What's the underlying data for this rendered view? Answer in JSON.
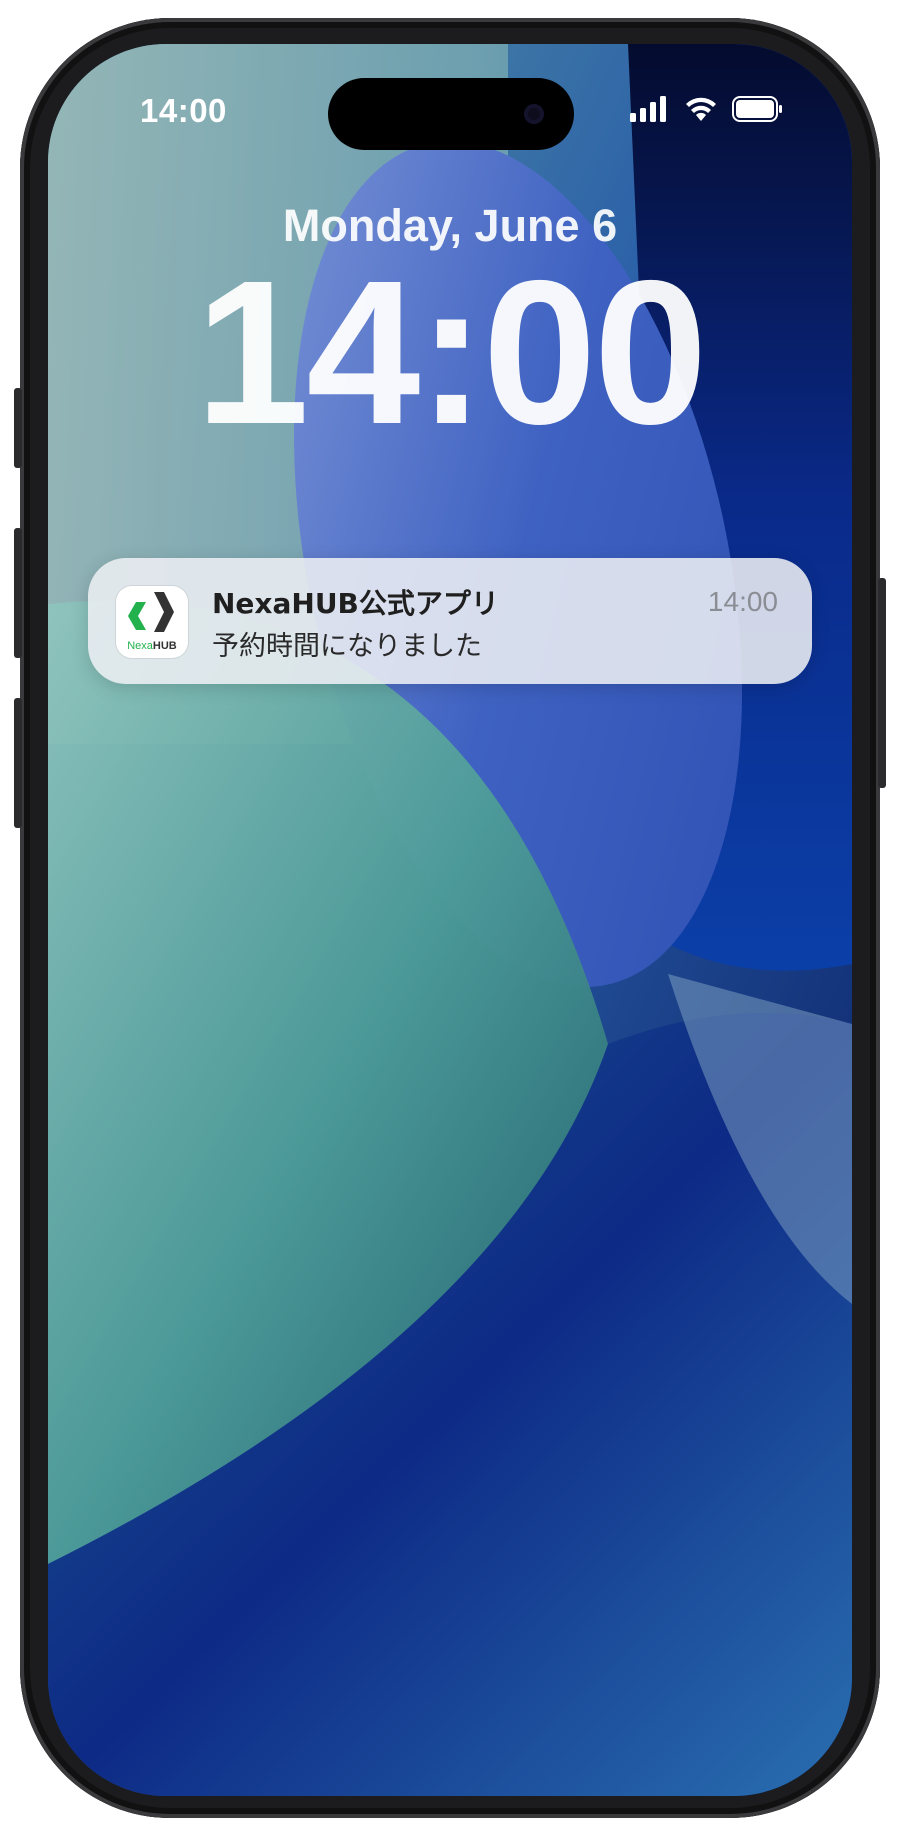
{
  "status_bar": {
    "time": "14:00",
    "icons": [
      "signal-icon",
      "wifi-icon",
      "battery-icon"
    ]
  },
  "lock_screen": {
    "date": "Monday, June 6",
    "clock": "14:00"
  },
  "notification": {
    "app_name": "NexaHUB公式アプリ",
    "time": "14:00",
    "message": "予約時間になりました",
    "icon": {
      "label_part1": "Nexa",
      "label_part2": "HUB",
      "accent_color": "#22b14c",
      "dark_color": "#333333"
    }
  }
}
